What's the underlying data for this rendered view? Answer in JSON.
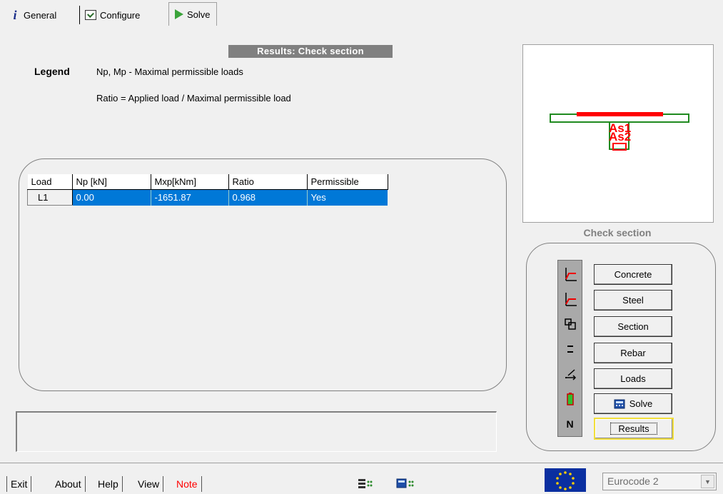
{
  "tabs": [
    {
      "label": "General",
      "icon": "info-icon"
    },
    {
      "label": "Configure",
      "icon": "checklist-icon"
    },
    {
      "label": "Solve",
      "icon": "play-icon",
      "active": true
    }
  ],
  "results_title": "Results: Check section",
  "legend": {
    "label": "Legend",
    "line1": "Np, Mp  - Maximal permissible loads",
    "line2": "Ratio  =  Applied load / Maximal permissible load"
  },
  "table": {
    "headers": [
      "Load",
      "Np [kN]",
      "Mxp[kNm]",
      "Ratio",
      "Permissible"
    ],
    "rows": [
      {
        "load": "L1",
        "np": "0.00",
        "mxp": "-1651.87",
        "ratio": "0.968",
        "permissible": "Yes"
      }
    ]
  },
  "preview": {
    "labels": [
      "As1",
      "As2"
    ]
  },
  "check_section_title": "Check section",
  "tool_buttons": {
    "concrete": "Concrete",
    "steel": "Steel",
    "section": "Section",
    "rebar": "Rebar",
    "loads": "Loads",
    "solve": "Solve",
    "results": "Results"
  },
  "strip_icons": [
    "concrete-diagram-icon",
    "steel-diagram-icon",
    "section-shape-icon",
    "rebar-icon",
    "loads-icon",
    "battery-icon",
    "n-icon"
  ],
  "strip_n_label": "N",
  "bottom": {
    "exit": "Exit",
    "about": "About",
    "help": "Help",
    "view": "View",
    "note": "Note"
  },
  "code_select": {
    "value": "Eurocode 2"
  },
  "colors": {
    "selection": "#0078d7",
    "note_text": "#ff0000",
    "section_green": "#1f8a1f",
    "rebar_red": "#ff0000",
    "eu_flag": "#0a2fa0"
  }
}
